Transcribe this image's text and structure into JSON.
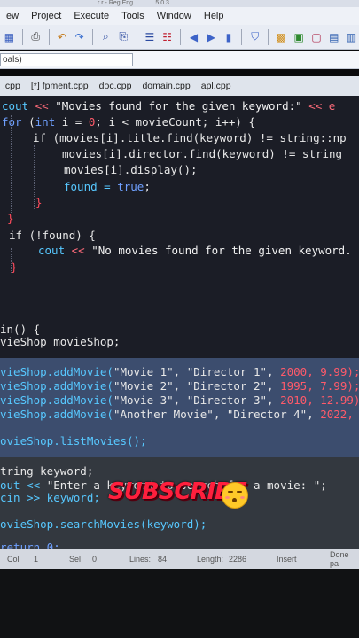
{
  "window": {
    "title_fragment": "r  r - Reg Eng .. .. .. .. 5.0.3"
  },
  "menu": {
    "items": [
      "ew",
      "Project",
      "Execute",
      "Tools",
      "Window",
      "Help"
    ]
  },
  "toolbar": {
    "icons": [
      "grid-icon",
      "print-icon",
      "undo-icon",
      "redo-icon",
      "find-icon",
      "replace-icon",
      "indent-icon",
      "unindent-icon",
      "bookmark-prev-icon",
      "bookmark-next-icon",
      "bookmark-icon",
      "class-icon",
      "new-class-icon",
      "window-icon",
      "layout-icon",
      "layout2-icon"
    ]
  },
  "combo": {
    "value": "oals)"
  },
  "tabs": [
    {
      "label": ".cpp",
      "active": false
    },
    {
      "label": "[*] fpment.cpp",
      "active": false
    },
    {
      "label": "doc.cpp",
      "active": false
    },
    {
      "label": "domain.cpp",
      "active": false
    },
    {
      "label": "apl.cpp",
      "active": false
    }
  ],
  "code": {
    "l1_a": "cout",
    "l1_b": " << ",
    "l1_c": "\"Movies found for the given keyword:\"",
    "l1_d": " << e",
    "l2_a": "for",
    "l2_b": " (",
    "l2_c": "int",
    "l2_d": " i = ",
    "l2_e": "0",
    "l2_f": "; i < movieCount; i++) {",
    "l3": "if (movies[i].title.find(keyword) != string::np",
    "l4": "movies[i].director.find(keyword) != string",
    "l5": "movies[i].display();",
    "l6_a": "found = ",
    "l6_b": "true",
    "l6_c": ";",
    "l7": "}",
    "l8": "}",
    "l9": "if (!found) {",
    "l10_a": "cout",
    "l10_b": " << ",
    "l10_c": "\"No movies found for the given keyword.",
    "l11": "}",
    "l12": "in() {",
    "l13": "vieShop movieShop;",
    "l14_a": "vieShop.addMovie(",
    "l14_b": "\"Movie 1\", \"Director 1\", ",
    "l14_c": "2000",
    "l14_d": ", 9.99);",
    "l15_a": "vieShop.addMovie(",
    "l15_b": "\"Movie 2\", \"Director 2\", ",
    "l15_c": "1995",
    "l15_d": ", 7.99);",
    "l16_a": "vieShop.addMovie(",
    "l16_b": "\"Movie 3\", \"Director 3\", ",
    "l16_c": "2010",
    "l16_d": ", 12.99);",
    "l17_a": "vieShop.addMovie(",
    "l17_b": "\"Another Movie\", \"Director 4\", ",
    "l17_c": "2022",
    "l17_d": ", 1",
    "l18": "ovieShop.listMovies();",
    "l19": "tring keyword;",
    "l20_a": "out << ",
    "l20_b": "\"Enter a keyword to search for a movie: \"",
    "l20_c": ";",
    "l21": "cin >> keyword;",
    "l22": "ovieShop.searchMovies(keyword);",
    "l23": "return 0;"
  },
  "overlay": {
    "subscribe": "SUBSCRIBE"
  },
  "status": {
    "col_label": "Col",
    "col_value": "1",
    "sel_label": "Sel",
    "sel_value": "0",
    "lines_label": "Lines:",
    "lines_value": "84",
    "length_label": "Length:",
    "length_value": "2286",
    "mode": "Insert",
    "msg": "Done pa"
  },
  "colors": {
    "editor_bg": "#1b1d26",
    "selection": "#3c4d6e",
    "keyword": "#6fa0ff",
    "number": "#ff5a6a",
    "subscribe": "#ff1f3d"
  }
}
